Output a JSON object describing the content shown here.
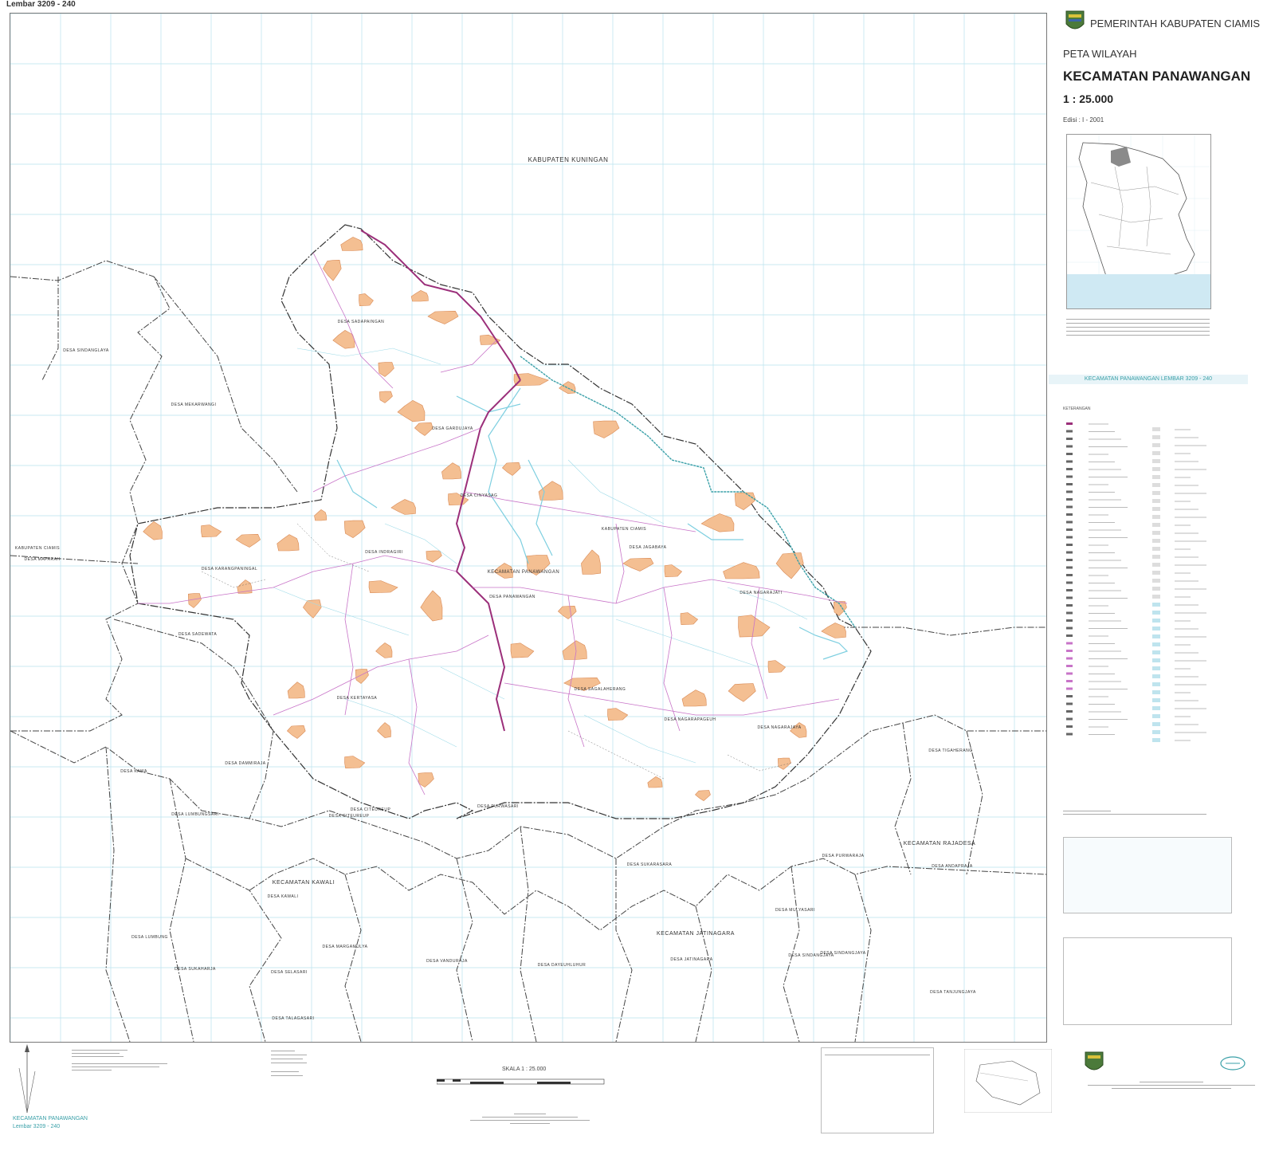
{
  "sheet_label": "Lembar 3209 - 240",
  "header": {
    "government": "PEMERINTAH KABUPATEN CIAMIS",
    "map_type": "PETA WILAYAH",
    "district": "KECAMATAN PANAWANGAN",
    "scale": "1 : 25.000",
    "edition": "Edisi : I - 2001",
    "sheet_banner": "KECAMATAN PANAWANGAN LEMBAR 3209 - 240"
  },
  "map_labels": {
    "kuningan": "KABUPATEN KUNINGAN",
    "ciamis": "KABUPATEN CIAMIS",
    "panawangan_kec": "KECAMATAN PANAWANGAN",
    "rajadesa_kec": "KECAMATAN RAJADESA",
    "kawali_kec": "KECAMATAN KAWALI",
    "jatinagara_kec": "KECAMATAN JATINAGARA",
    "ciamis_west": "KABUPATEN CIAMIS",
    "desa": [
      "DESA SINDANGLAYA",
      "DESA MEKARWANGI",
      "DESA SADAPAINGAN",
      "DESA GARDUJAYA",
      "DESA CINYASAG",
      "DESA INDRAGIRI",
      "DESA KARANGPANINGAL",
      "DESA MAPARAH",
      "DESA NAGARAJATI",
      "DESA JAGABAYA",
      "DESA PANAWANGAN",
      "DESA SADEWATA",
      "DESA KERTAYASA",
      "DESA SAGALAHERANG",
      "DESA NAGARAPAGEUH",
      "DESA NAGARAJAYA",
      "DESA TIGAHERANG",
      "DESA KAWA",
      "DESA DAMMIRAJA",
      "DESA LUMBUNGSARI",
      "DESA CITEUREUP",
      "DESA CITEUREUP",
      "DESA PURWASARI",
      "DESA SUKARASARA",
      "DESA PURWARAJA",
      "DESA ANDAPRAJA",
      "DESA MULYASARI",
      "DESA SINDANGJAYA",
      "DESA KAWALI",
      "DESA LUMBUNG",
      "DESA MARGAMULYA",
      "DESA SUKAHARJA",
      "DESA SELASARI",
      "DESA VANDURAJA",
      "DESA DAYEUHLUHUR",
      "DESA JATINAGARA",
      "DESA TANJUNGJAYA",
      "DESA TALAGASARI",
      "DESA SINDANGJAYA"
    ]
  },
  "legend_title": "KETERANGAN",
  "scale_bar": {
    "label": "SKALA 1 : 25.000"
  },
  "footer_left": {
    "title": "KECAMATAN PANAWANGAN",
    "sheet": "Lembar 3209 - 240"
  },
  "colors": {
    "settlement": "#f4bf92",
    "road": "#9b2f7a",
    "river": "#7ecfe0",
    "grid": "#b8e2ee",
    "border": "#444444",
    "subroad": "#c874c8"
  }
}
